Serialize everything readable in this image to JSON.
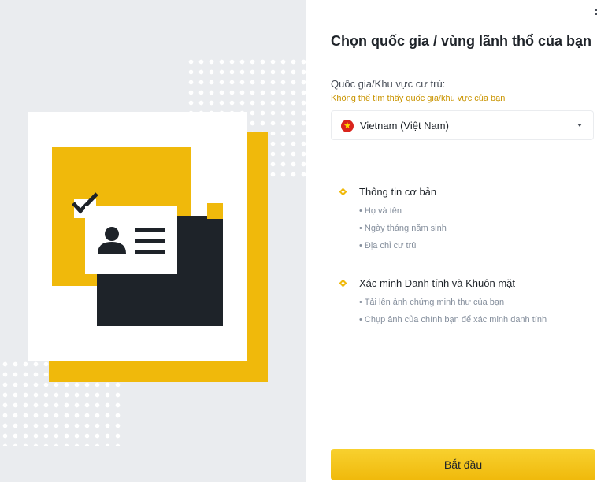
{
  "page": {
    "title": "Chọn quốc gia / vùng lãnh thổ của bạn",
    "country_label": "Quốc gia/Khu vực cư trú:",
    "help_link": "Không thể tìm thấy quốc gia/khu vực của bạn",
    "selected_country": "Vietnam (Việt Nam)",
    "sections": [
      {
        "title": "Thông tin cơ bản",
        "items": [
          "• Họ và tên",
          "• Ngày tháng năm sinh",
          "• Địa chỉ cư trú"
        ]
      },
      {
        "title": "Xác minh Danh tính và Khuôn mặt",
        "items": [
          "• Tải lên ảnh chứng minh thư của bạn",
          "• Chụp ảnh của chính bạn để xác minh danh tính"
        ]
      }
    ],
    "start_button": "Bắt đầu"
  },
  "colors": {
    "accent": "#f0b90b",
    "dark": "#1e2329",
    "link": "#c99400",
    "panel_bg": "#eaecef"
  },
  "icons": {
    "flag": "vietnam-flag-icon",
    "caret": "chevron-down-icon",
    "bullet": "diamond-bullet-icon",
    "illustration": "id-verification-illustration"
  }
}
